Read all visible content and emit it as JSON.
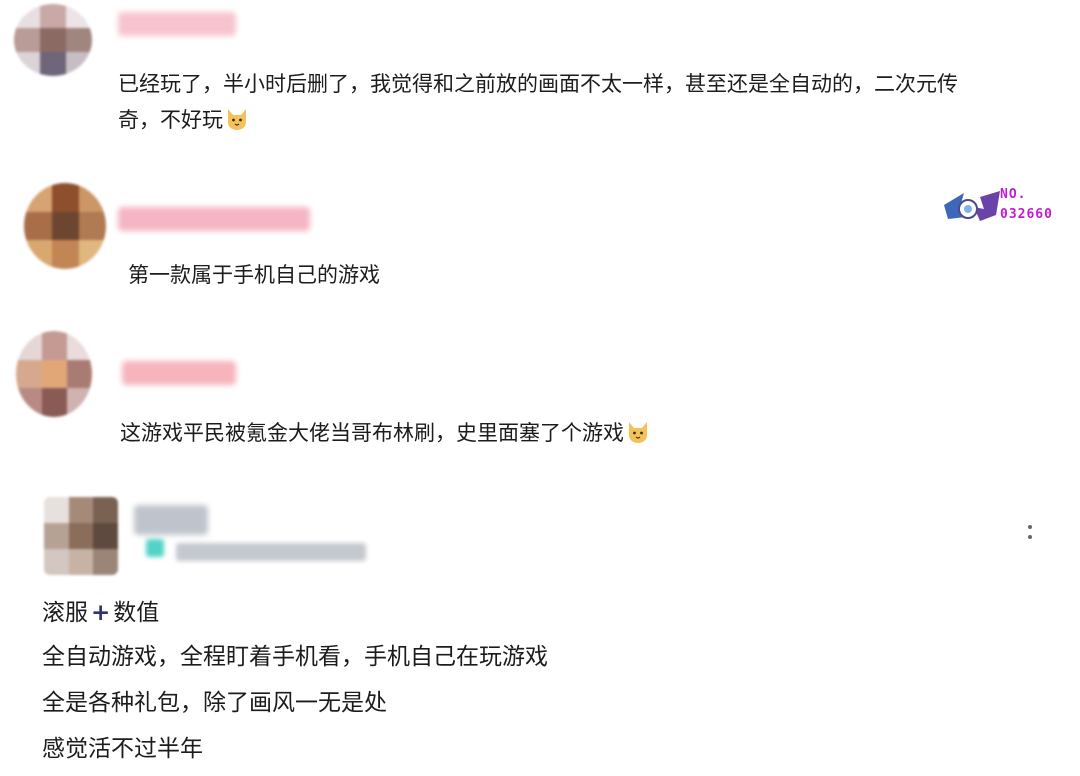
{
  "comments": [
    {
      "lines": [
        "已经玩了，半小时后删了，我觉得和之前放的画面不太一样，甚至还是全自动的，二次元传",
        "奇，不好玩"
      ],
      "emoji": "cat-face-emoji"
    },
    {
      "lines": [
        "第一款属于手机自己的游戏"
      ],
      "badge": {
        "no_label": "NO.",
        "number": "032660"
      }
    },
    {
      "lines": [
        "这游戏平民被氪金大佬当哥布林刷，史里面塞了个游戏"
      ],
      "emoji": "cat-face-emoji"
    },
    {
      "line1_left": "滚服",
      "line1_plus": "+",
      "line1_right": "数值",
      "lines": [
        "全自动游戏，全程盯着手机看，手机自己在玩游戏",
        "全是各种礼包，除了画风一无是处",
        "感觉活不过半年"
      ]
    }
  ],
  "icons": {
    "emoji": "cat-face-emoji",
    "more": "more-vertical-icon",
    "badge": "level-badge-icon"
  },
  "colors": {
    "badge_text": "#c21bd1",
    "plus": "#2e3470",
    "name_blur": "#f4b2c0"
  }
}
